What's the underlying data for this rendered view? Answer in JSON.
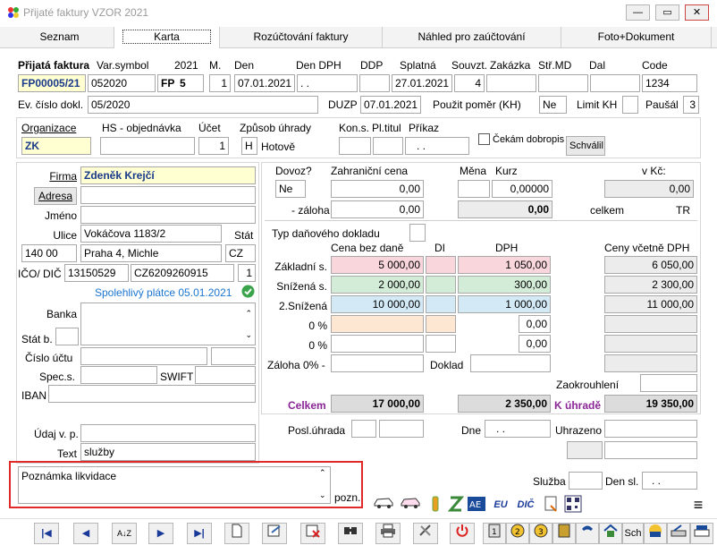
{
  "window": {
    "title": "Přijaté faktury VZOR  2021",
    "minimize": "—",
    "restore": "▭",
    "close": "✕"
  },
  "tabs": [
    "Seznam",
    "Karta",
    "Rozúčtování faktury",
    "Náhled pro zaúčtování",
    "Foto+Dokument"
  ],
  "header": {
    "label_doc": "Přijatá faktura",
    "label_varsymbol": "Var.symbol",
    "label_year": "2021",
    "label_m": "M.",
    "label_den": "Den",
    "label_den_dph": "Den DPH",
    "label_ddp": "DDP",
    "label_splatna": "Splatná",
    "label_souvzt": "Souvzt.",
    "label_zakazka": "Zakázka",
    "label_strmd": "Stř.MD",
    "label_dal": "Dal",
    "label_code": "Code",
    "doc_number": "FP00005/21",
    "var_symbol": "052020",
    "doc_series": "FP",
    "doc_series_num": "5",
    "month": "1",
    "den": "07.01.2021",
    "den_dph": ".  .",
    "ddp": "",
    "splatna": "27.01.2021",
    "souvzt": "4",
    "zakazka": "",
    "strmd": "",
    "dal": "",
    "code": "1234",
    "label_ev_cislo": "Ev. číslo dokl.",
    "ev_cislo": "05/2020",
    "label_duzp": "DUZP",
    "duzp": "07.01.2021",
    "label_pouzit_pomer": "Použit poměr (KH)",
    "pouzit_pomer": "Ne",
    "label_limit_kh": "Limit KH",
    "limit_kh": "",
    "label_pausal": "Paušál",
    "pausal": "3"
  },
  "org": {
    "label_organizace": "Organizace",
    "label_hs": "HS - objednávka",
    "label_ucet": "Účet",
    "label_zpusob": "Způsob úhrady",
    "label_kons": "Kon.s.",
    "label_pltitul": "Pl.titul",
    "label_prikaz": "Příkaz",
    "organizace": "ZK",
    "hs": "",
    "ucet": "1",
    "zpusob_code": "H",
    "zpusob_text": "Hotově",
    "kons": "",
    "pltitul": "",
    "prikaz": ".  .",
    "cekam_label": "Čekám dobropis",
    "schvalil": "Schválil"
  },
  "partner": {
    "label_firma": "Firma",
    "firma": "Zdeněk Krejčí",
    "adresa_btn": "Adresa",
    "label_jmeno": "Jméno",
    "label_ulice": "Ulice",
    "ulice": "Vokáčova 1183/2",
    "label_stat": "Stát",
    "psc": "140 00",
    "mesto": "Praha 4, Michle",
    "stat": "CZ",
    "label_ico": "IČO/ DIČ",
    "ico": "13150529",
    "dic": "CZ6209260915",
    "ico_num": "1",
    "spolehlivy": "Spolehlivý plátce 05.01.2021",
    "label_banka": "Banka",
    "label_statb": "Stát b.",
    "label_cislo_uctu": "Číslo účtu",
    "label_specs": "Spec.s.",
    "label_swift": "SWIFT",
    "label_iban": "IBAN",
    "label_udaj": "Údaj v. p.",
    "label_text": "Text",
    "text": "služby"
  },
  "amounts": {
    "label_dovoz": "Dovoz?",
    "label_zahranicni": "Zahraniční cena",
    "label_mena": "Měna",
    "label_kurz": "Kurz",
    "label_vkc": "v Kč:",
    "dovoz": "Ne",
    "zahranicni": "0,00",
    "mena": "",
    "kurz": "0,00000",
    "vkc": "0,00",
    "label_zaloha": "- záloha",
    "zaloha": "0,00",
    "zaloha_total": "0,00",
    "label_celkem_small": "celkem",
    "label_tr": "TR",
    "label_typ_dan": "Typ daňového dokladu",
    "label_cena_bez": "Cena bez daně",
    "label_di": "DI",
    "label_dph": "DPH",
    "label_ceny_vc": "Ceny včetně DPH",
    "rows": [
      {
        "label": "Základní s.",
        "base": "5 000,00",
        "dph": "1 050,00",
        "total": "6 050,00"
      },
      {
        "label": "Snížená s.",
        "base": "2 000,00",
        "dph": "300,00",
        "total": "2 300,00"
      },
      {
        "label": "2.Snížená",
        "base": "10 000,00",
        "dph": "1 000,00",
        "total": "11 000,00"
      },
      {
        "label": "0 %",
        "base": "",
        "dph": "0,00",
        "total": ""
      },
      {
        "label": "0 %",
        "base": "",
        "dph": "0,00",
        "total": ""
      }
    ],
    "label_zaloha0": "Záloha 0% -",
    "label_doklad": "Doklad",
    "label_zaokrouhleni": "Zaokrouhlení",
    "label_celkem": "Celkem",
    "celkem_base": "17 000,00",
    "celkem_dph": "2 350,00",
    "label_k_uhrade": "K úhradě",
    "k_uhrade": "19 350,00",
    "label_posl_uhrada": "Posl.úhrada",
    "label_dne": "Dne",
    "dne": ".  .",
    "label_uhrazeno": "Uhrazeno"
  },
  "note": {
    "placeholder": "Poznámka likvidace",
    "label_pozn": "pozn.",
    "label_sluzba": "Služba",
    "label_den_sl": "Den sl.",
    "den_sl": ".  ."
  },
  "toolbar2": [
    "car-icon",
    "car2-icon",
    "bottle-icon",
    "s-icon",
    "ae-icon",
    "EU",
    "DIČ",
    "doc-icon",
    "qr-icon",
    "≡"
  ],
  "toolbar": [
    "|◀",
    "◀",
    "A↓Z",
    "▶",
    "▶|",
    "new",
    "edit",
    "delete",
    "find",
    "print",
    "tools",
    "power",
    "1",
    "2",
    "3",
    "book",
    "phone",
    "home",
    "Sch",
    "face",
    "scan"
  ],
  "colors": {
    "accent_red": "#e02a2a",
    "blue": "#1a75d1",
    "purple": "#8a2596"
  }
}
